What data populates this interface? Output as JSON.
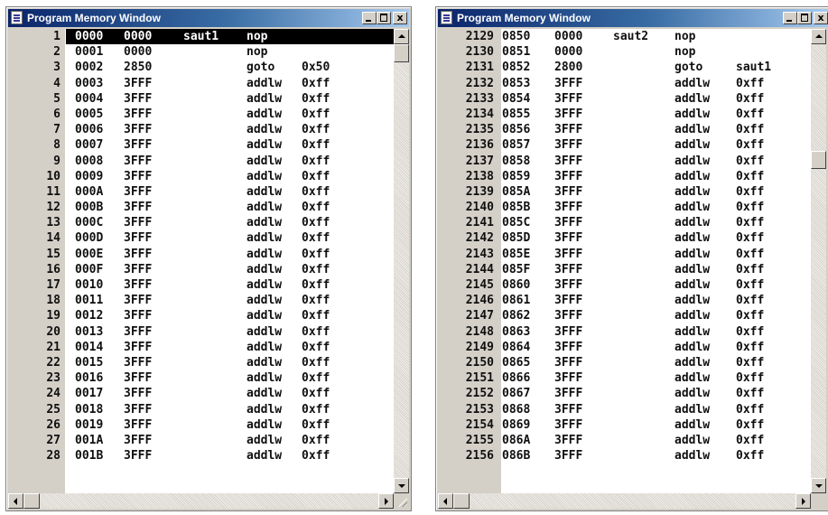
{
  "windows": [
    {
      "title": "Program Memory Window",
      "close_glyph": "x",
      "rows": [
        {
          "num": "1",
          "addr": "0000",
          "op": "0000",
          "label": "saut1",
          "instr": "nop",
          "arg": "",
          "selected": true
        },
        {
          "num": "2",
          "addr": "0001",
          "op": "0000",
          "label": "",
          "instr": "nop",
          "arg": ""
        },
        {
          "num": "3",
          "addr": "0002",
          "op": "2850",
          "label": "",
          "instr": "goto",
          "arg": "0x50"
        },
        {
          "num": "4",
          "addr": "0003",
          "op": "3FFF",
          "label": "",
          "instr": "addlw",
          "arg": "0xff"
        },
        {
          "num": "5",
          "addr": "0004",
          "op": "3FFF",
          "label": "",
          "instr": "addlw",
          "arg": "0xff"
        },
        {
          "num": "6",
          "addr": "0005",
          "op": "3FFF",
          "label": "",
          "instr": "addlw",
          "arg": "0xff"
        },
        {
          "num": "7",
          "addr": "0006",
          "op": "3FFF",
          "label": "",
          "instr": "addlw",
          "arg": "0xff"
        },
        {
          "num": "8",
          "addr": "0007",
          "op": "3FFF",
          "label": "",
          "instr": "addlw",
          "arg": "0xff"
        },
        {
          "num": "9",
          "addr": "0008",
          "op": "3FFF",
          "label": "",
          "instr": "addlw",
          "arg": "0xff"
        },
        {
          "num": "10",
          "addr": "0009",
          "op": "3FFF",
          "label": "",
          "instr": "addlw",
          "arg": "0xff"
        },
        {
          "num": "11",
          "addr": "000A",
          "op": "3FFF",
          "label": "",
          "instr": "addlw",
          "arg": "0xff"
        },
        {
          "num": "12",
          "addr": "000B",
          "op": "3FFF",
          "label": "",
          "instr": "addlw",
          "arg": "0xff"
        },
        {
          "num": "13",
          "addr": "000C",
          "op": "3FFF",
          "label": "",
          "instr": "addlw",
          "arg": "0xff"
        },
        {
          "num": "14",
          "addr": "000D",
          "op": "3FFF",
          "label": "",
          "instr": "addlw",
          "arg": "0xff"
        },
        {
          "num": "15",
          "addr": "000E",
          "op": "3FFF",
          "label": "",
          "instr": "addlw",
          "arg": "0xff"
        },
        {
          "num": "16",
          "addr": "000F",
          "op": "3FFF",
          "label": "",
          "instr": "addlw",
          "arg": "0xff"
        },
        {
          "num": "17",
          "addr": "0010",
          "op": "3FFF",
          "label": "",
          "instr": "addlw",
          "arg": "0xff"
        },
        {
          "num": "18",
          "addr": "0011",
          "op": "3FFF",
          "label": "",
          "instr": "addlw",
          "arg": "0xff"
        },
        {
          "num": "19",
          "addr": "0012",
          "op": "3FFF",
          "label": "",
          "instr": "addlw",
          "arg": "0xff"
        },
        {
          "num": "20",
          "addr": "0013",
          "op": "3FFF",
          "label": "",
          "instr": "addlw",
          "arg": "0xff"
        },
        {
          "num": "21",
          "addr": "0014",
          "op": "3FFF",
          "label": "",
          "instr": "addlw",
          "arg": "0xff"
        },
        {
          "num": "22",
          "addr": "0015",
          "op": "3FFF",
          "label": "",
          "instr": "addlw",
          "arg": "0xff"
        },
        {
          "num": "23",
          "addr": "0016",
          "op": "3FFF",
          "label": "",
          "instr": "addlw",
          "arg": "0xff"
        },
        {
          "num": "24",
          "addr": "0017",
          "op": "3FFF",
          "label": "",
          "instr": "addlw",
          "arg": "0xff"
        },
        {
          "num": "25",
          "addr": "0018",
          "op": "3FFF",
          "label": "",
          "instr": "addlw",
          "arg": "0xff"
        },
        {
          "num": "26",
          "addr": "0019",
          "op": "3FFF",
          "label": "",
          "instr": "addlw",
          "arg": "0xff"
        },
        {
          "num": "27",
          "addr": "001A",
          "op": "3FFF",
          "label": "",
          "instr": "addlw",
          "arg": "0xff"
        },
        {
          "num": "28",
          "addr": "001B",
          "op": "3FFF",
          "label": "",
          "instr": "addlw",
          "arg": "0xff"
        }
      ]
    },
    {
      "title": "Program Memory Window",
      "close_glyph": "x",
      "rows": [
        {
          "num": "2129",
          "addr": "0850",
          "op": "0000",
          "label": "saut2",
          "instr": "nop",
          "arg": ""
        },
        {
          "num": "2130",
          "addr": "0851",
          "op": "0000",
          "label": "",
          "instr": "nop",
          "arg": ""
        },
        {
          "num": "2131",
          "addr": "0852",
          "op": "2800",
          "label": "",
          "instr": "goto",
          "arg": "saut1"
        },
        {
          "num": "2132",
          "addr": "0853",
          "op": "3FFF",
          "label": "",
          "instr": "addlw",
          "arg": "0xff"
        },
        {
          "num": "2133",
          "addr": "0854",
          "op": "3FFF",
          "label": "",
          "instr": "addlw",
          "arg": "0xff"
        },
        {
          "num": "2134",
          "addr": "0855",
          "op": "3FFF",
          "label": "",
          "instr": "addlw",
          "arg": "0xff"
        },
        {
          "num": "2135",
          "addr": "0856",
          "op": "3FFF",
          "label": "",
          "instr": "addlw",
          "arg": "0xff"
        },
        {
          "num": "2136",
          "addr": "0857",
          "op": "3FFF",
          "label": "",
          "instr": "addlw",
          "arg": "0xff"
        },
        {
          "num": "2137",
          "addr": "0858",
          "op": "3FFF",
          "label": "",
          "instr": "addlw",
          "arg": "0xff"
        },
        {
          "num": "2138",
          "addr": "0859",
          "op": "3FFF",
          "label": "",
          "instr": "addlw",
          "arg": "0xff"
        },
        {
          "num": "2139",
          "addr": "085A",
          "op": "3FFF",
          "label": "",
          "instr": "addlw",
          "arg": "0xff"
        },
        {
          "num": "2140",
          "addr": "085B",
          "op": "3FFF",
          "label": "",
          "instr": "addlw",
          "arg": "0xff"
        },
        {
          "num": "2141",
          "addr": "085C",
          "op": "3FFF",
          "label": "",
          "instr": "addlw",
          "arg": "0xff"
        },
        {
          "num": "2142",
          "addr": "085D",
          "op": "3FFF",
          "label": "",
          "instr": "addlw",
          "arg": "0xff"
        },
        {
          "num": "2143",
          "addr": "085E",
          "op": "3FFF",
          "label": "",
          "instr": "addlw",
          "arg": "0xff"
        },
        {
          "num": "2144",
          "addr": "085F",
          "op": "3FFF",
          "label": "",
          "instr": "addlw",
          "arg": "0xff"
        },
        {
          "num": "2145",
          "addr": "0860",
          "op": "3FFF",
          "label": "",
          "instr": "addlw",
          "arg": "0xff"
        },
        {
          "num": "2146",
          "addr": "0861",
          "op": "3FFF",
          "label": "",
          "instr": "addlw",
          "arg": "0xff"
        },
        {
          "num": "2147",
          "addr": "0862",
          "op": "3FFF",
          "label": "",
          "instr": "addlw",
          "arg": "0xff"
        },
        {
          "num": "2148",
          "addr": "0863",
          "op": "3FFF",
          "label": "",
          "instr": "addlw",
          "arg": "0xff"
        },
        {
          "num": "2149",
          "addr": "0864",
          "op": "3FFF",
          "label": "",
          "instr": "addlw",
          "arg": "0xff"
        },
        {
          "num": "2150",
          "addr": "0865",
          "op": "3FFF",
          "label": "",
          "instr": "addlw",
          "arg": "0xff"
        },
        {
          "num": "2151",
          "addr": "0866",
          "op": "3FFF",
          "label": "",
          "instr": "addlw",
          "arg": "0xff"
        },
        {
          "num": "2152",
          "addr": "0867",
          "op": "3FFF",
          "label": "",
          "instr": "addlw",
          "arg": "0xff"
        },
        {
          "num": "2153",
          "addr": "0868",
          "op": "3FFF",
          "label": "",
          "instr": "addlw",
          "arg": "0xff"
        },
        {
          "num": "2154",
          "addr": "0869",
          "op": "3FFF",
          "label": "",
          "instr": "addlw",
          "arg": "0xff"
        },
        {
          "num": "2155",
          "addr": "086A",
          "op": "3FFF",
          "label": "",
          "instr": "addlw",
          "arg": "0xff"
        },
        {
          "num": "2156",
          "addr": "086B",
          "op": "3FFF",
          "label": "",
          "instr": "addlw",
          "arg": "0xff"
        }
      ]
    }
  ]
}
